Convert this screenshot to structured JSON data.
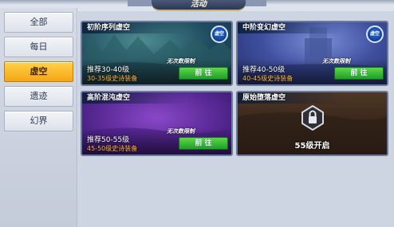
{
  "header": {
    "title": "活动"
  },
  "sidebar": {
    "items": [
      {
        "label": "全部"
      },
      {
        "label": "每日"
      },
      {
        "label": "虚空"
      },
      {
        "label": "遗迹"
      },
      {
        "label": "幻界"
      }
    ],
    "active_index": 2
  },
  "cards": [
    {
      "title": "初阶序列虚空",
      "badge": "虚空",
      "no_limit": "无次数限制",
      "recommend": "推荐30-40级",
      "gear": "30-35级史诗装备",
      "button": "前 往"
    },
    {
      "title": "中阶变幻虚空",
      "badge": "虚空",
      "no_limit": "无次数限制",
      "recommend": "推荐40-50级",
      "gear": "40-45级史诗装备",
      "button": "前 往"
    },
    {
      "title": "高阶混沌虚空",
      "badge": "虚空",
      "no_limit": "无次数限制",
      "recommend": "推荐50-55级",
      "gear": "45-50级史诗装备",
      "button": "前 往"
    },
    {
      "title": "原始堕落虚空",
      "locked_text": "55级开启"
    }
  ],
  "colors": {
    "active_tab": "#f5a514",
    "go_button": "#1f9e2a",
    "gear_text": "#ffb43a",
    "badge": "#1a52b8"
  }
}
